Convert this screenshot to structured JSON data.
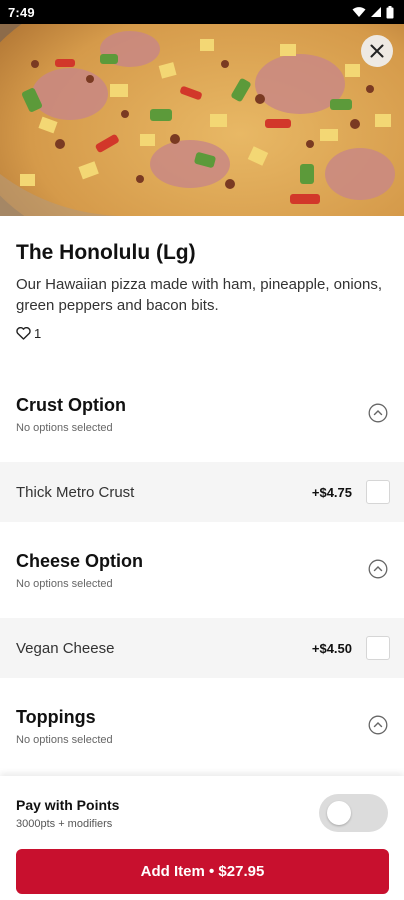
{
  "status_bar": {
    "time": "7:49",
    "icons": [
      "wifi-icon",
      "signal-icon",
      "battery-icon"
    ]
  },
  "hero": {
    "icon_close": "close-icon"
  },
  "item": {
    "title": "The Honolulu (Lg)",
    "description": "Our Hawaiian pizza made with ham, pineapple, onions, green peppers and bacon bits.",
    "likes": "1"
  },
  "sections": [
    {
      "title": "Crust Option",
      "subtitle": "No options selected",
      "options": [
        {
          "label": "Thick Metro Crust",
          "price": "+$4.75"
        }
      ]
    },
    {
      "title": "Cheese Option",
      "subtitle": "No options selected",
      "options": [
        {
          "label": "Vegan Cheese",
          "price": "+$4.50"
        }
      ]
    },
    {
      "title": "Toppings",
      "subtitle": "No options selected",
      "options": []
    }
  ],
  "bottom": {
    "points_title": "Pay with Points",
    "points_sub": "3000pts + modifiers",
    "points_enabled": false,
    "add_button": "Add Item • $27.95"
  },
  "colors": {
    "accent": "#c8102e",
    "row_bg": "#f5f5f5",
    "toggle_off": "#dcdcdc"
  }
}
